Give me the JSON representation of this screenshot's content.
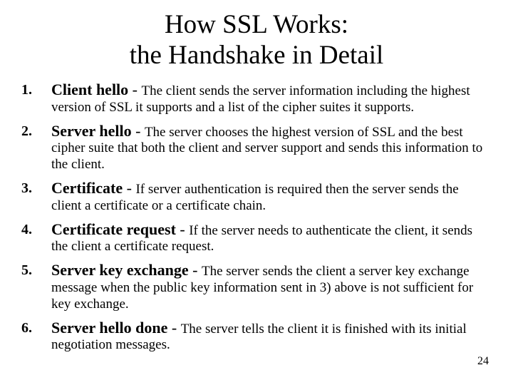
{
  "title_line1": "How SSL Works:",
  "title_line2": "the Handshake in Detail",
  "items": [
    {
      "n": "1.",
      "lead": "Client hello",
      "desc": "The client sends the server information including the highest version of SSL it supports and a list of the cipher suites it supports."
    },
    {
      "n": "2.",
      "lead": "Server hello",
      "desc": "The server chooses the highest version of SSL and the best cipher suite that both the client and server support and sends this information to the client."
    },
    {
      "n": "3.",
      "lead": "Certificate",
      "desc": "If server authentication is required then the server sends the client a certificate or a certificate chain."
    },
    {
      "n": "4.",
      "lead": "Certificate request",
      "desc": "If the server needs to authenticate the client, it sends the client a certificate request."
    },
    {
      "n": "5.",
      "lead": "Server key exchange",
      "desc": "The server sends the client a server key exchange message when the public key information sent in 3) above is not sufficient for key exchange."
    },
    {
      "n": "6.",
      "lead": "Server hello done",
      "desc": "The server tells the client it is finished with its initial negotiation messages."
    }
  ],
  "page_number": "24"
}
